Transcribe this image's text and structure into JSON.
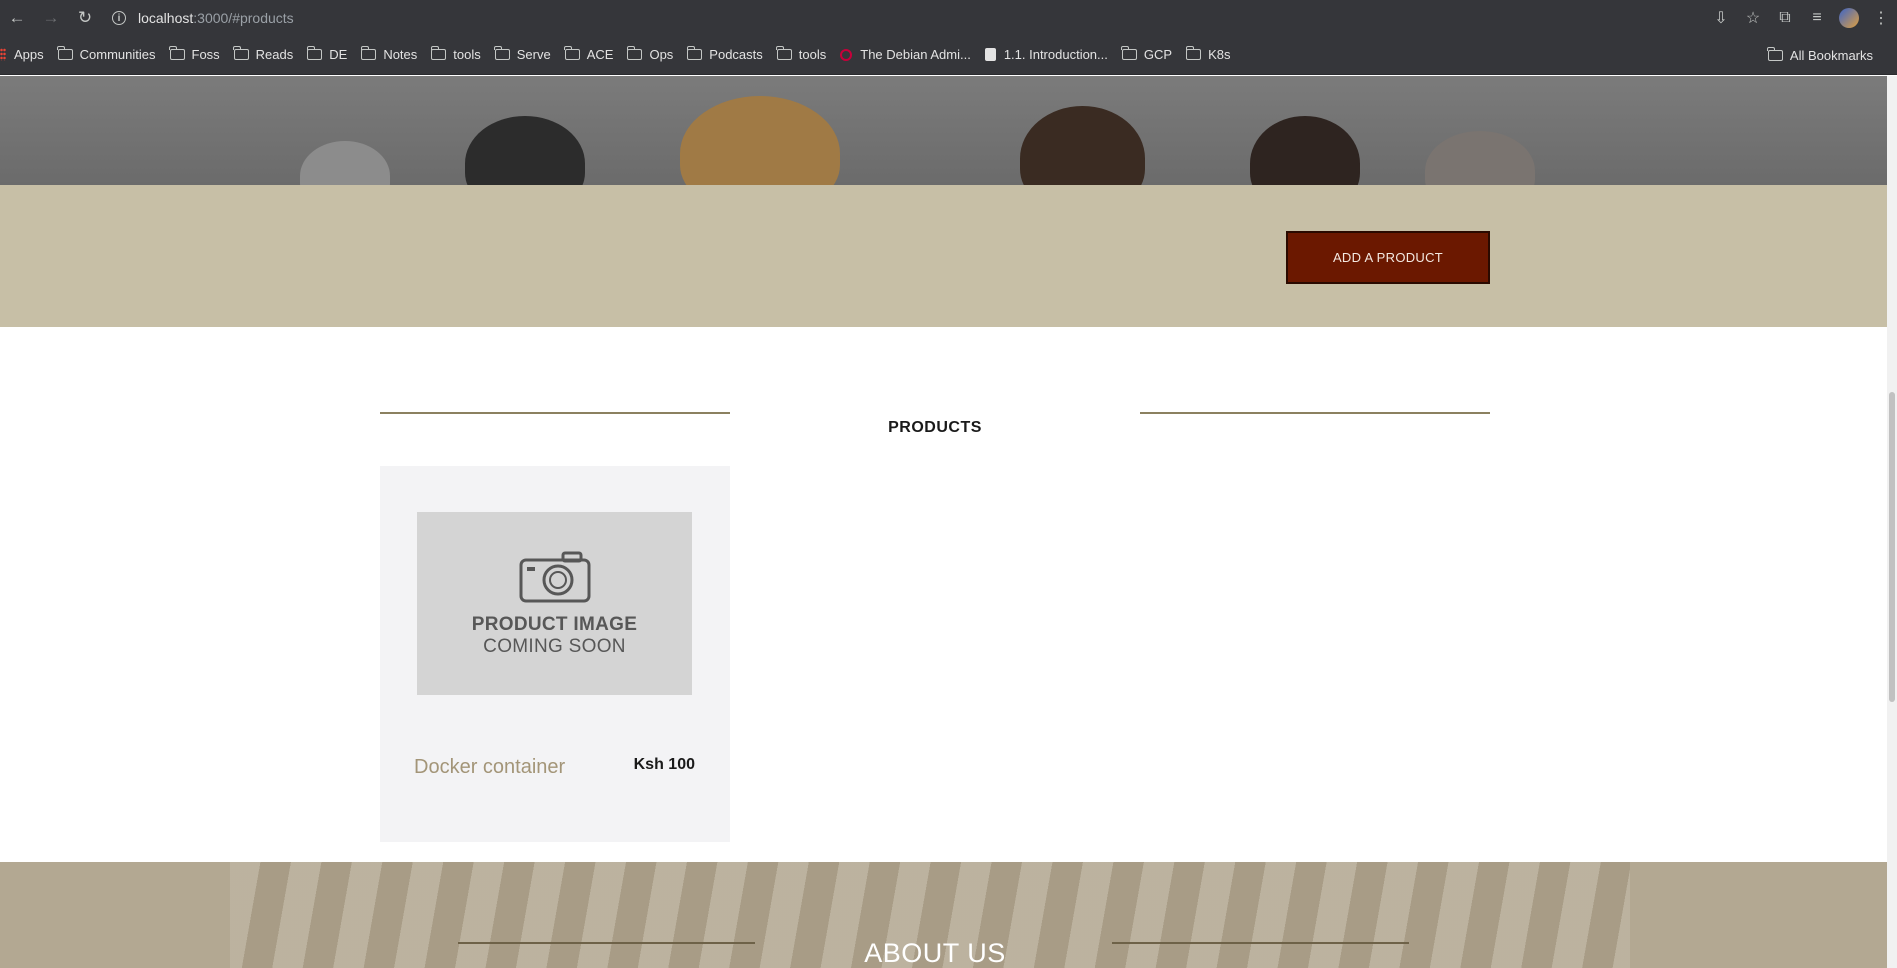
{
  "browser": {
    "url_host": "localhost",
    "url_path": ":3000/#products",
    "bookmarks": [
      "Apps",
      "Communities",
      "Foss",
      "Reads",
      "DE",
      "Notes",
      "tools",
      "Serve",
      "ACE",
      "Ops",
      "Podcasts",
      "tools",
      "The Debian Admi...",
      "1.1. Introduction...",
      "GCP",
      "K8s"
    ],
    "all_bookmarks": "All Bookmarks"
  },
  "action_bar": {
    "add_product_label": "ADD A PRODUCT"
  },
  "products_section": {
    "title": "PRODUCTS",
    "items": [
      {
        "image_line1": "PRODUCT IMAGE",
        "image_line2": "COMING SOON",
        "name": "Docker container",
        "price": "Ksh 100"
      }
    ]
  },
  "about_section": {
    "title": "ABOUT US"
  },
  "colors": {
    "accent_button": "#6b1800",
    "action_bar_bg": "#c7bfa6",
    "product_name": "#a39578",
    "divider": "#8b8160"
  }
}
